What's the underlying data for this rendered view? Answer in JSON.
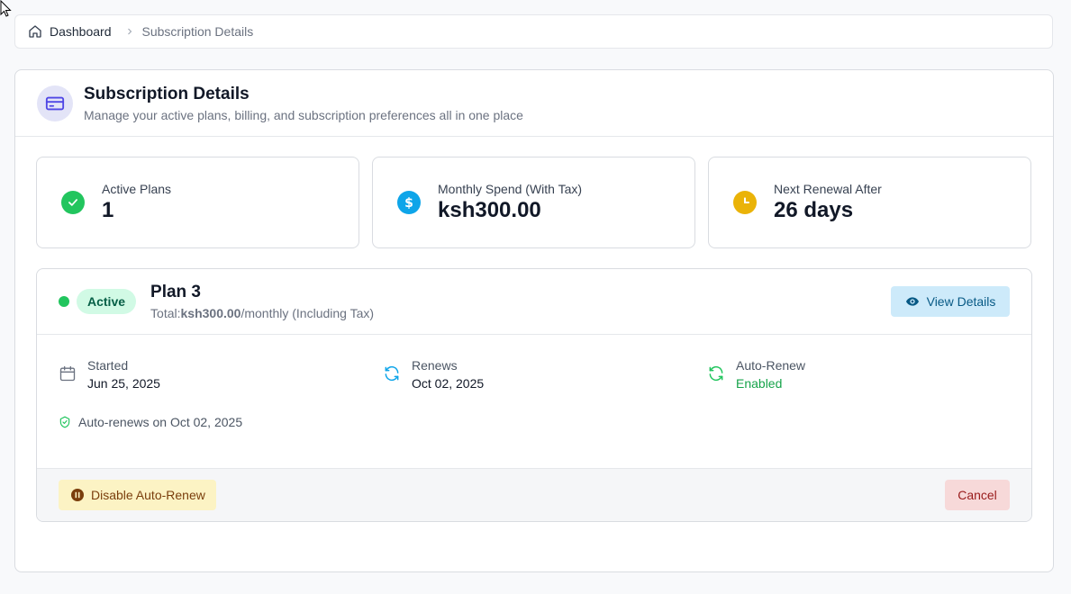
{
  "breadcrumb": {
    "home_label": "Dashboard",
    "current_label": "Subscription Details",
    "home_icon": "home-icon",
    "separator_icon": "chevron-right-icon"
  },
  "header": {
    "title": "Subscription Details",
    "subtitle": "Manage your active plans, billing, and subscription preferences all in one place",
    "icon": "credit-card-icon"
  },
  "stats": [
    {
      "label": "Active Plans",
      "value": "1",
      "icon": "check-circle-icon",
      "color": "#22c55e"
    },
    {
      "label": "Monthly Spend (With Tax)",
      "value": "ksh300.00",
      "icon": "dollar-icon",
      "color": "#0ea5e9"
    },
    {
      "label": "Next Renewal After",
      "value": "26 days",
      "icon": "clock-icon",
      "color": "#eab308"
    }
  ],
  "plan": {
    "status": "Active",
    "name": "Plan 3",
    "total_prefix": "Total:",
    "total_amount": "ksh300.00",
    "total_suffix": "/monthly (Including Tax)",
    "view_details_label": "View Details",
    "details": [
      {
        "label": "Started",
        "value": "Jun 25, 2025",
        "icon": "calendar-icon"
      },
      {
        "label": "Renews",
        "value": "Oct 02, 2025",
        "icon": "refresh-icon"
      },
      {
        "label": "Auto-Renew",
        "value": "Enabled",
        "icon": "refresh-icon"
      }
    ],
    "auto_renew_note": "Auto-renews on Oct 02, 2025",
    "disable_label": "Disable Auto-Renew",
    "cancel_label": "Cancel"
  }
}
